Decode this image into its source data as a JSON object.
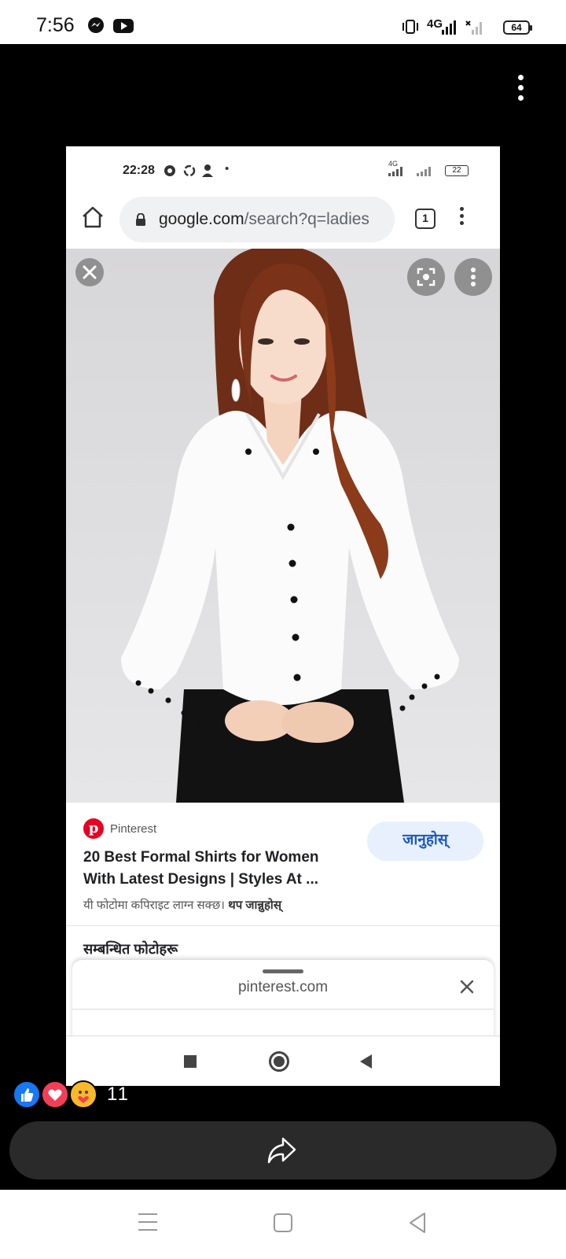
{
  "status_bar": {
    "time": "7:56",
    "app_icons": [
      "messenger-icon",
      "youtube-icon"
    ],
    "network": "4G",
    "battery": "64"
  },
  "inner_screenshot": {
    "status_bar": {
      "time": "22:28",
      "network": "4G",
      "battery": "22"
    },
    "browser": {
      "url_domain": "google.com",
      "url_path": "/search?q=ladies",
      "tab_count": "1"
    },
    "image_viewer": {
      "source": "Pinterest",
      "title": "20 Best Formal Shirts for Women With Latest Designs | Styles At ...",
      "visit_label": "जानुहोस्",
      "copyright_text": "यी फोटोमा कपिराइट लाग्न सक्छ।",
      "copyright_link": "थप जान्नुहोस्",
      "related_heading": "सम्बन्धित फोटोहरू"
    },
    "bottom_sheet": {
      "domain": "pinterest.com"
    }
  },
  "reactions": {
    "types": [
      "like",
      "love",
      "care"
    ],
    "count": "11"
  },
  "colors": {
    "pinterest_red": "#e60023",
    "visit_button_bg": "#e8f0fe",
    "visit_button_text": "#1a57c5",
    "like_blue": "#1877f2",
    "love_red": "#f33e58",
    "share_bar": "#2a2a2a"
  }
}
